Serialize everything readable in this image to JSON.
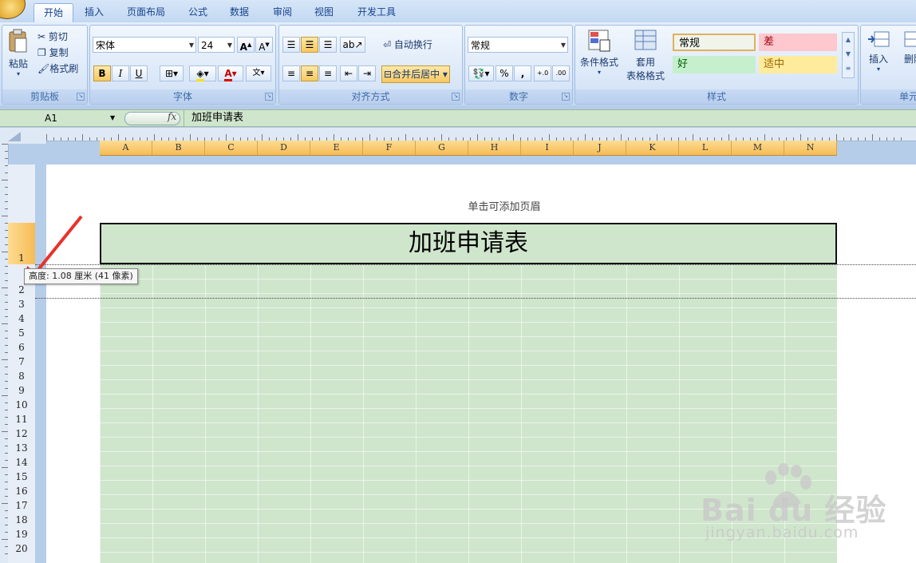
{
  "tabs": [
    "开始",
    "插入",
    "页面布局",
    "公式",
    "数据",
    "审阅",
    "视图",
    "开发工具"
  ],
  "clipboard": {
    "paste": "粘贴",
    "cut": "剪切",
    "copy": "复制",
    "format_painter": "格式刷",
    "label": "剪贴板"
  },
  "font": {
    "name": "宋体",
    "size": "24",
    "label": "字体",
    "bold": "B",
    "italic": "I",
    "underline": "U"
  },
  "alignment": {
    "wrap": "自动换行",
    "merge": "合并后居中",
    "label": "对齐方式"
  },
  "number": {
    "format": "常规",
    "percent": "%",
    "comma": ",",
    "label": "数字"
  },
  "styles": {
    "conditional": "条件格式",
    "table_format_1": "套用",
    "table_format_2": "表格格式",
    "normal": "常规",
    "bad": "差",
    "good": "好",
    "neutral": "适中",
    "label": "样式"
  },
  "cells": {
    "insert": "插入",
    "delete": "删除",
    "label": "单元"
  },
  "formula_bar": {
    "name_box": "A1",
    "fx": "fx",
    "value": "加班申请表"
  },
  "columns": [
    "A",
    "B",
    "C",
    "D",
    "E",
    "F",
    "G",
    "H",
    "I",
    "J",
    "K",
    "L",
    "M",
    "N"
  ],
  "rows": [
    "1",
    "2",
    "3",
    "4",
    "5",
    "6",
    "7",
    "8",
    "9",
    "10",
    "11",
    "12",
    "13",
    "14",
    "15",
    "16",
    "17",
    "18",
    "19",
    "20"
  ],
  "sheet": {
    "header_hint": "单击可添加页眉",
    "title": "加班申请表",
    "tooltip": "高度: 1.08 厘米 (41 像素)"
  },
  "watermark": {
    "brand": "Bai du 经验",
    "url": "jingyan.baidu.com"
  },
  "colors": {
    "ribbon": "#cfe0f5",
    "cell_fill": "#cfe6cc",
    "col_header": "#f6bc55",
    "accent_arrow": "#e8322a",
    "bad_fill": "#ffc7ce",
    "neutral_fill": "#ffeb9c",
    "good_fill": "#c6efce"
  }
}
